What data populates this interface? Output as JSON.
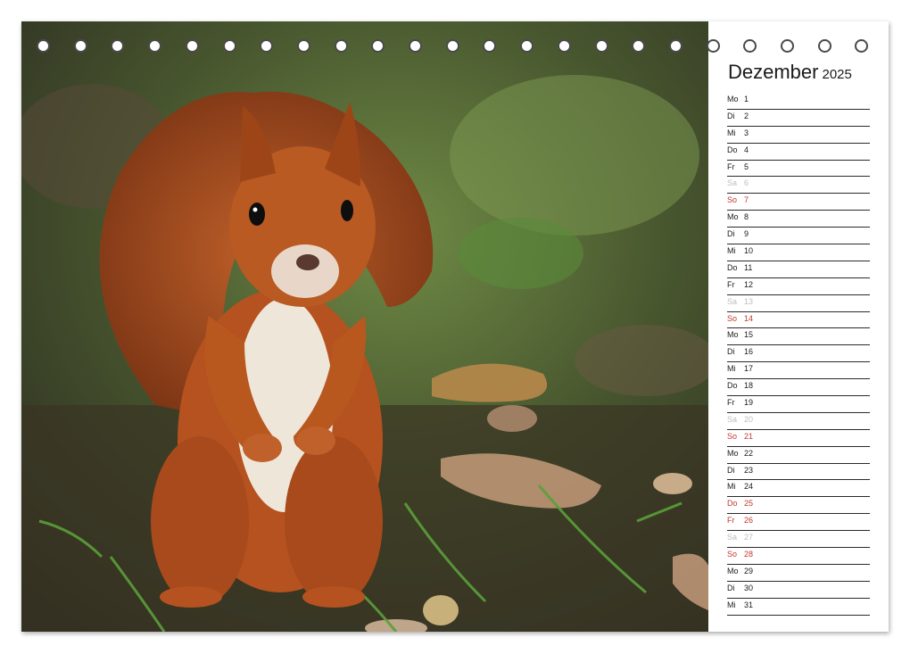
{
  "calendar": {
    "month": "Dezember",
    "year": "2025",
    "days": [
      {
        "wd": "Mo",
        "d": "1",
        "type": "normal"
      },
      {
        "wd": "Di",
        "d": "2",
        "type": "normal"
      },
      {
        "wd": "Mi",
        "d": "3",
        "type": "normal"
      },
      {
        "wd": "Do",
        "d": "4",
        "type": "normal"
      },
      {
        "wd": "Fr",
        "d": "5",
        "type": "normal"
      },
      {
        "wd": "Sa",
        "d": "6",
        "type": "sat"
      },
      {
        "wd": "So",
        "d": "7",
        "type": "red"
      },
      {
        "wd": "Mo",
        "d": "8",
        "type": "normal"
      },
      {
        "wd": "Di",
        "d": "9",
        "type": "normal"
      },
      {
        "wd": "Mi",
        "d": "10",
        "type": "normal"
      },
      {
        "wd": "Do",
        "d": "11",
        "type": "normal"
      },
      {
        "wd": "Fr",
        "d": "12",
        "type": "normal"
      },
      {
        "wd": "Sa",
        "d": "13",
        "type": "sat"
      },
      {
        "wd": "So",
        "d": "14",
        "type": "red"
      },
      {
        "wd": "Mo",
        "d": "15",
        "type": "normal"
      },
      {
        "wd": "Di",
        "d": "16",
        "type": "normal"
      },
      {
        "wd": "Mi",
        "d": "17",
        "type": "normal"
      },
      {
        "wd": "Do",
        "d": "18",
        "type": "normal"
      },
      {
        "wd": "Fr",
        "d": "19",
        "type": "normal"
      },
      {
        "wd": "Sa",
        "d": "20",
        "type": "sat"
      },
      {
        "wd": "So",
        "d": "21",
        "type": "red"
      },
      {
        "wd": "Mo",
        "d": "22",
        "type": "normal"
      },
      {
        "wd": "Di",
        "d": "23",
        "type": "normal"
      },
      {
        "wd": "Mi",
        "d": "24",
        "type": "normal"
      },
      {
        "wd": "Do",
        "d": "25",
        "type": "red"
      },
      {
        "wd": "Fr",
        "d": "26",
        "type": "red"
      },
      {
        "wd": "Sa",
        "d": "27",
        "type": "sat"
      },
      {
        "wd": "So",
        "d": "28",
        "type": "red"
      },
      {
        "wd": "Mo",
        "d": "29",
        "type": "normal"
      },
      {
        "wd": "Di",
        "d": "30",
        "type": "normal"
      },
      {
        "wd": "Mi",
        "d": "31",
        "type": "normal"
      }
    ]
  },
  "colors": {
    "holiday_red": "#c0392b",
    "saturday_gray": "#bdbdbd",
    "squirrel_fur": "#b5521f"
  },
  "photo": {
    "icon": "squirrel-photo"
  }
}
